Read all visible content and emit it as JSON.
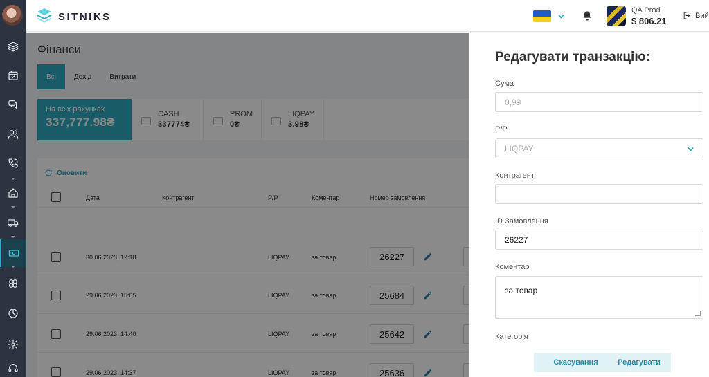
{
  "app": {
    "brand": "SITNIKS"
  },
  "colors": {
    "accent": "#2fa9bd",
    "sidebar": "#2b3440",
    "flag_blue": "#1e5bc6",
    "flag_yellow": "#f5cf19"
  },
  "sidebar": {
    "items": [
      {
        "icon": "layers-icon"
      },
      {
        "icon": "calendar-icon"
      },
      {
        "icon": "chat-icon"
      },
      {
        "icon": "users-icon"
      },
      {
        "icon": "phone-icon"
      },
      {
        "icon": "home-icon"
      },
      {
        "icon": "truck-icon"
      },
      {
        "icon": "finance-icon",
        "active": true
      },
      {
        "icon": "integrations-icon"
      },
      {
        "icon": "analytics-icon"
      },
      {
        "icon": "settings-icon"
      },
      {
        "icon": "support-icon"
      }
    ]
  },
  "header": {
    "account_name": "QA Prod",
    "balance": "$ 806.21",
    "logout_label": "Вий"
  },
  "main": {
    "title": "Фінанси",
    "tabs": [
      {
        "label": "Всі"
      },
      {
        "label": "Дохід"
      },
      {
        "label": "Витрати"
      }
    ],
    "total_card": {
      "label": "На всіх рахунках",
      "value": "337,777.98₴"
    },
    "accounts": [
      {
        "name": "CASH",
        "amount": "337774₴"
      },
      {
        "name": "PROM",
        "amount": "0₴"
      },
      {
        "name": "LIQPAY",
        "amount": "3.98₴"
      }
    ],
    "refresh_label": "Оновити",
    "table": {
      "columns": [
        "Дата",
        "Контрагент",
        "Р/Р",
        "Коментар",
        "Номер замовлення"
      ],
      "rows": [
        {
          "date": "30.06.2023, 12:18",
          "account": "LIQPAY",
          "comment": "за товар",
          "order": "26227"
        },
        {
          "date": "29.06.2023, 15:05",
          "account": "LIQPAY",
          "comment": "за товар",
          "order": "25684"
        },
        {
          "date": "29.06.2023, 14:40",
          "account": "LIQPAY",
          "comment": "за товар",
          "order": "25642"
        },
        {
          "date": "29.06.2023, 14:37",
          "account": "LIQPAY",
          "comment": "за товар",
          "order": "25636"
        }
      ]
    }
  },
  "drawer": {
    "title": "Редагувати транзакцію:",
    "fields": {
      "amount": {
        "label": "Сума",
        "placeholder": "0,99"
      },
      "account": {
        "label": "Р/Р",
        "value": "LIQPAY"
      },
      "counterparty": {
        "label": "Контрагент",
        "value": ""
      },
      "order_id": {
        "label": "ID Замовлення",
        "value": "26227"
      },
      "comment": {
        "label": "Коментар",
        "value": "за товар"
      },
      "category": {
        "label": "Категорія"
      }
    },
    "cancel_label": "Скасування",
    "submit_label": "Редагувати"
  }
}
